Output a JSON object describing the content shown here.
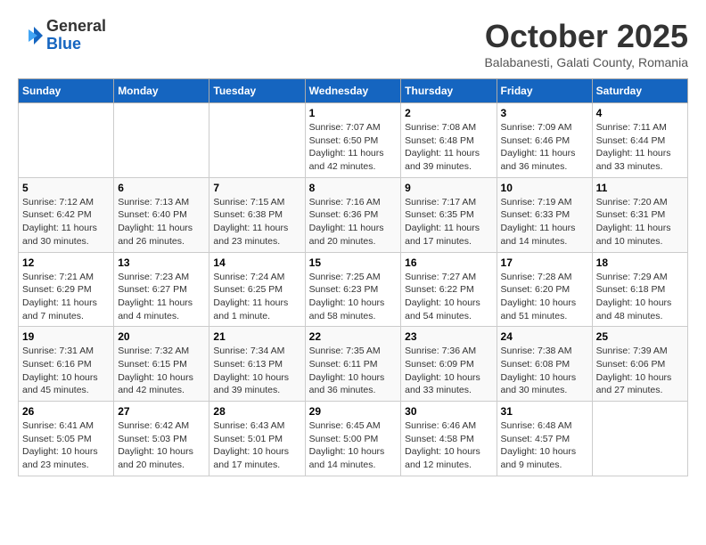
{
  "logo": {
    "general": "General",
    "blue": "Blue"
  },
  "header": {
    "month": "October 2025",
    "location": "Balabanesti, Galati County, Romania"
  },
  "weekdays": [
    "Sunday",
    "Monday",
    "Tuesday",
    "Wednesday",
    "Thursday",
    "Friday",
    "Saturday"
  ],
  "weeks": [
    [
      {
        "day": "",
        "info": ""
      },
      {
        "day": "",
        "info": ""
      },
      {
        "day": "",
        "info": ""
      },
      {
        "day": "1",
        "info": "Sunrise: 7:07 AM\nSunset: 6:50 PM\nDaylight: 11 hours\nand 42 minutes."
      },
      {
        "day": "2",
        "info": "Sunrise: 7:08 AM\nSunset: 6:48 PM\nDaylight: 11 hours\nand 39 minutes."
      },
      {
        "day": "3",
        "info": "Sunrise: 7:09 AM\nSunset: 6:46 PM\nDaylight: 11 hours\nand 36 minutes."
      },
      {
        "day": "4",
        "info": "Sunrise: 7:11 AM\nSunset: 6:44 PM\nDaylight: 11 hours\nand 33 minutes."
      }
    ],
    [
      {
        "day": "5",
        "info": "Sunrise: 7:12 AM\nSunset: 6:42 PM\nDaylight: 11 hours\nand 30 minutes."
      },
      {
        "day": "6",
        "info": "Sunrise: 7:13 AM\nSunset: 6:40 PM\nDaylight: 11 hours\nand 26 minutes."
      },
      {
        "day": "7",
        "info": "Sunrise: 7:15 AM\nSunset: 6:38 PM\nDaylight: 11 hours\nand 23 minutes."
      },
      {
        "day": "8",
        "info": "Sunrise: 7:16 AM\nSunset: 6:36 PM\nDaylight: 11 hours\nand 20 minutes."
      },
      {
        "day": "9",
        "info": "Sunrise: 7:17 AM\nSunset: 6:35 PM\nDaylight: 11 hours\nand 17 minutes."
      },
      {
        "day": "10",
        "info": "Sunrise: 7:19 AM\nSunset: 6:33 PM\nDaylight: 11 hours\nand 14 minutes."
      },
      {
        "day": "11",
        "info": "Sunrise: 7:20 AM\nSunset: 6:31 PM\nDaylight: 11 hours\nand 10 minutes."
      }
    ],
    [
      {
        "day": "12",
        "info": "Sunrise: 7:21 AM\nSunset: 6:29 PM\nDaylight: 11 hours\nand 7 minutes."
      },
      {
        "day": "13",
        "info": "Sunrise: 7:23 AM\nSunset: 6:27 PM\nDaylight: 11 hours\nand 4 minutes."
      },
      {
        "day": "14",
        "info": "Sunrise: 7:24 AM\nSunset: 6:25 PM\nDaylight: 11 hours\nand 1 minute."
      },
      {
        "day": "15",
        "info": "Sunrise: 7:25 AM\nSunset: 6:23 PM\nDaylight: 10 hours\nand 58 minutes."
      },
      {
        "day": "16",
        "info": "Sunrise: 7:27 AM\nSunset: 6:22 PM\nDaylight: 10 hours\nand 54 minutes."
      },
      {
        "day": "17",
        "info": "Sunrise: 7:28 AM\nSunset: 6:20 PM\nDaylight: 10 hours\nand 51 minutes."
      },
      {
        "day": "18",
        "info": "Sunrise: 7:29 AM\nSunset: 6:18 PM\nDaylight: 10 hours\nand 48 minutes."
      }
    ],
    [
      {
        "day": "19",
        "info": "Sunrise: 7:31 AM\nSunset: 6:16 PM\nDaylight: 10 hours\nand 45 minutes."
      },
      {
        "day": "20",
        "info": "Sunrise: 7:32 AM\nSunset: 6:15 PM\nDaylight: 10 hours\nand 42 minutes."
      },
      {
        "day": "21",
        "info": "Sunrise: 7:34 AM\nSunset: 6:13 PM\nDaylight: 10 hours\nand 39 minutes."
      },
      {
        "day": "22",
        "info": "Sunrise: 7:35 AM\nSunset: 6:11 PM\nDaylight: 10 hours\nand 36 minutes."
      },
      {
        "day": "23",
        "info": "Sunrise: 7:36 AM\nSunset: 6:09 PM\nDaylight: 10 hours\nand 33 minutes."
      },
      {
        "day": "24",
        "info": "Sunrise: 7:38 AM\nSunset: 6:08 PM\nDaylight: 10 hours\nand 30 minutes."
      },
      {
        "day": "25",
        "info": "Sunrise: 7:39 AM\nSunset: 6:06 PM\nDaylight: 10 hours\nand 27 minutes."
      }
    ],
    [
      {
        "day": "26",
        "info": "Sunrise: 6:41 AM\nSunset: 5:05 PM\nDaylight: 10 hours\nand 23 minutes."
      },
      {
        "day": "27",
        "info": "Sunrise: 6:42 AM\nSunset: 5:03 PM\nDaylight: 10 hours\nand 20 minutes."
      },
      {
        "day": "28",
        "info": "Sunrise: 6:43 AM\nSunset: 5:01 PM\nDaylight: 10 hours\nand 17 minutes."
      },
      {
        "day": "29",
        "info": "Sunrise: 6:45 AM\nSunset: 5:00 PM\nDaylight: 10 hours\nand 14 minutes."
      },
      {
        "day": "30",
        "info": "Sunrise: 6:46 AM\nSunset: 4:58 PM\nDaylight: 10 hours\nand 12 minutes."
      },
      {
        "day": "31",
        "info": "Sunrise: 6:48 AM\nSunset: 4:57 PM\nDaylight: 10 hours\nand 9 minutes."
      },
      {
        "day": "",
        "info": ""
      }
    ]
  ]
}
